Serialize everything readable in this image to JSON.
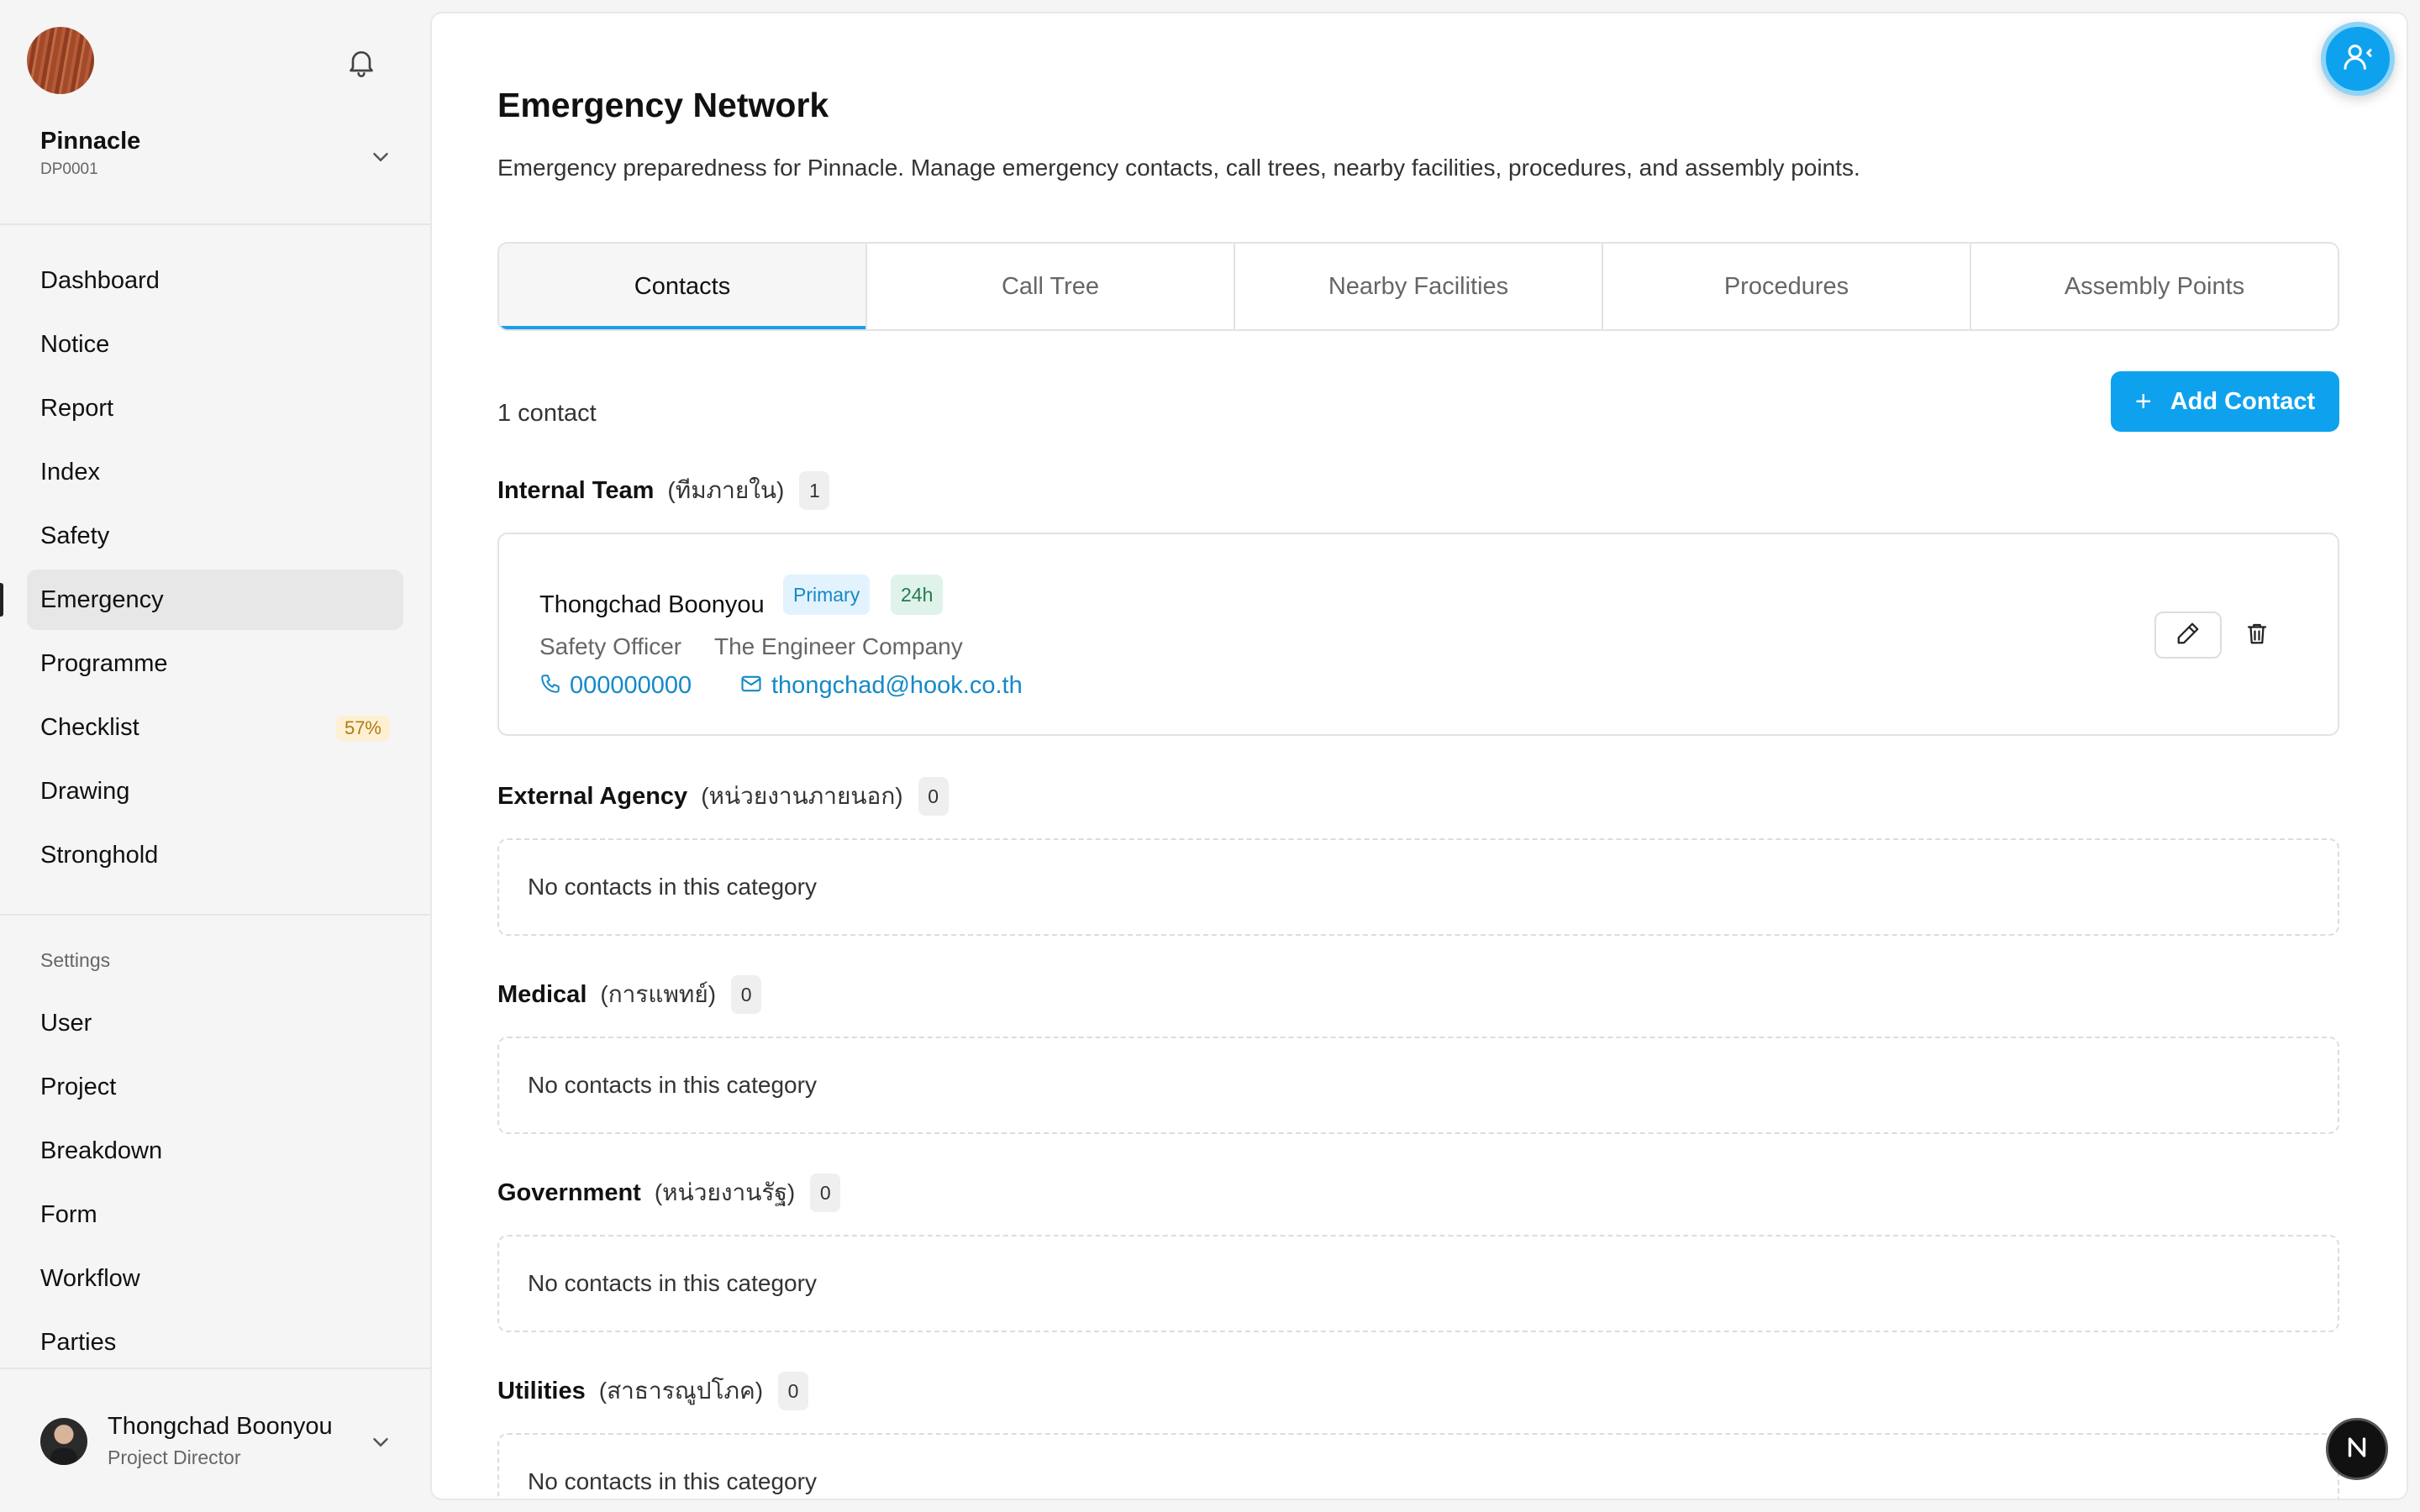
{
  "project": {
    "name": "Pinnacle",
    "code": "DP0001"
  },
  "nav": {
    "items": [
      {
        "label": "Dashboard"
      },
      {
        "label": "Notice"
      },
      {
        "label": "Report"
      },
      {
        "label": "Index"
      },
      {
        "label": "Safety"
      },
      {
        "label": "Emergency",
        "active": true
      },
      {
        "label": "Programme"
      },
      {
        "label": "Checklist",
        "badge": "57%"
      },
      {
        "label": "Drawing"
      },
      {
        "label": "Stronghold"
      }
    ],
    "settings_label": "Settings",
    "settings_items": [
      {
        "label": "User"
      },
      {
        "label": "Project"
      },
      {
        "label": "Breakdown"
      },
      {
        "label": "Form"
      },
      {
        "label": "Workflow"
      },
      {
        "label": "Parties"
      }
    ]
  },
  "user": {
    "name": "Thongchad Boonyou",
    "role": "Project Director"
  },
  "page": {
    "title": "Emergency Network",
    "description": "Emergency preparedness for Pinnacle. Manage emergency contacts, call trees, nearby facilities, procedures, and assembly points."
  },
  "tabs": [
    {
      "label": "Contacts",
      "active": true
    },
    {
      "label": "Call Tree"
    },
    {
      "label": "Nearby Facilities"
    },
    {
      "label": "Procedures"
    },
    {
      "label": "Assembly Points"
    }
  ],
  "contacts": {
    "count_text": "1 contact",
    "add_label": "Add Contact",
    "empty_text": "No contacts in this category",
    "categories": [
      {
        "name": "Internal Team",
        "thai": "(ทีมภายใน)",
        "count": "1"
      },
      {
        "name": "External Agency",
        "thai": "(หน่วยงานภายนอก)",
        "count": "0"
      },
      {
        "name": "Medical",
        "thai": "(การแพทย์)",
        "count": "0"
      },
      {
        "name": "Government",
        "thai": "(หน่วยงานรัฐ)",
        "count": "0"
      },
      {
        "name": "Utilities",
        "thai": "(สาธารณูปโภค)",
        "count": "0"
      }
    ],
    "internal_contact": {
      "name": "Thongchad Boonyou",
      "badges": [
        "Primary",
        "24h"
      ],
      "role": "Safety Officer",
      "company": "The Engineer Company",
      "phone": "000000000",
      "email": "thongchad@hook.co.th"
    }
  },
  "colors": {
    "accent": "#0ea2ee",
    "link": "#1489c8",
    "badge_warning_bg": "#fdf0d2"
  },
  "icons": [
    "bell-icon",
    "chevron-down-icon",
    "plus-icon",
    "phone-icon",
    "mail-icon",
    "pencil-icon",
    "trash-icon",
    "user-switch-icon"
  ]
}
